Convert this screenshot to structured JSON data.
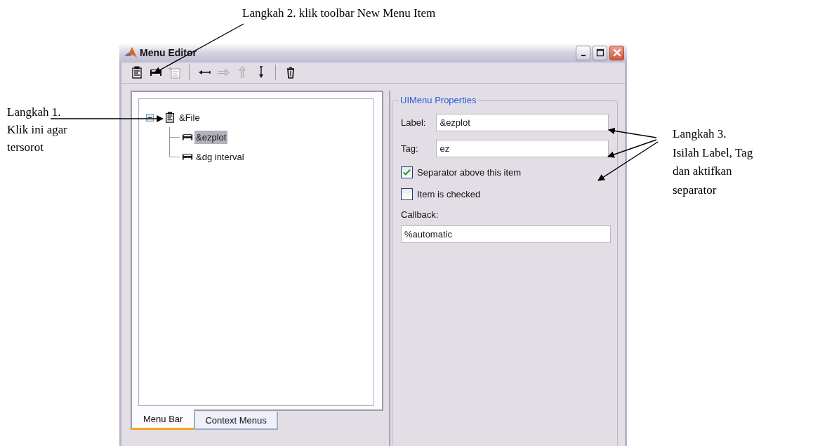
{
  "annotations": {
    "top": "Langkah 2. klik toolbar New Menu Item",
    "left": [
      "Langkah 1.",
      "Klik ini agar",
      "tersorot"
    ],
    "right": [
      "Langkah 3.",
      "Isilah Label, Tag",
      "dan aktifkan",
      "separator"
    ]
  },
  "window": {
    "title": "Menu Editor"
  },
  "toolbar": [
    {
      "kind": "new-menu",
      "disabled": false
    },
    {
      "kind": "new-item",
      "disabled": false
    },
    {
      "kind": "new-child",
      "disabled": true
    },
    {
      "kind": "separator"
    },
    {
      "kind": "left",
      "disabled": false
    },
    {
      "kind": "right",
      "disabled": true
    },
    {
      "kind": "up",
      "disabled": true
    },
    {
      "kind": "down",
      "disabled": false
    },
    {
      "kind": "separator"
    },
    {
      "kind": "delete",
      "disabled": false
    }
  ],
  "tree": [
    {
      "label": "&File",
      "kind": "menu",
      "expanded": true,
      "selected": false,
      "children": [
        {
          "label": "&ezplot",
          "kind": "item",
          "selected": true
        },
        {
          "label": "&dg interval",
          "kind": "item",
          "selected": false
        }
      ]
    }
  ],
  "tabs": [
    {
      "label": "Menu Bar",
      "selected": true
    },
    {
      "label": "Context Menus",
      "selected": false
    }
  ],
  "properties": {
    "title": "UIMenu Properties",
    "label": {
      "caption": "Label:",
      "value": "&ezplot"
    },
    "tag": {
      "caption": "Tag:",
      "value": "ez"
    },
    "checks": [
      {
        "label": "Separator above this item",
        "checked": true
      },
      {
        "label": "Item is checked",
        "checked": false
      }
    ],
    "callback": {
      "caption": "Callback:",
      "value": "%automatic"
    }
  }
}
